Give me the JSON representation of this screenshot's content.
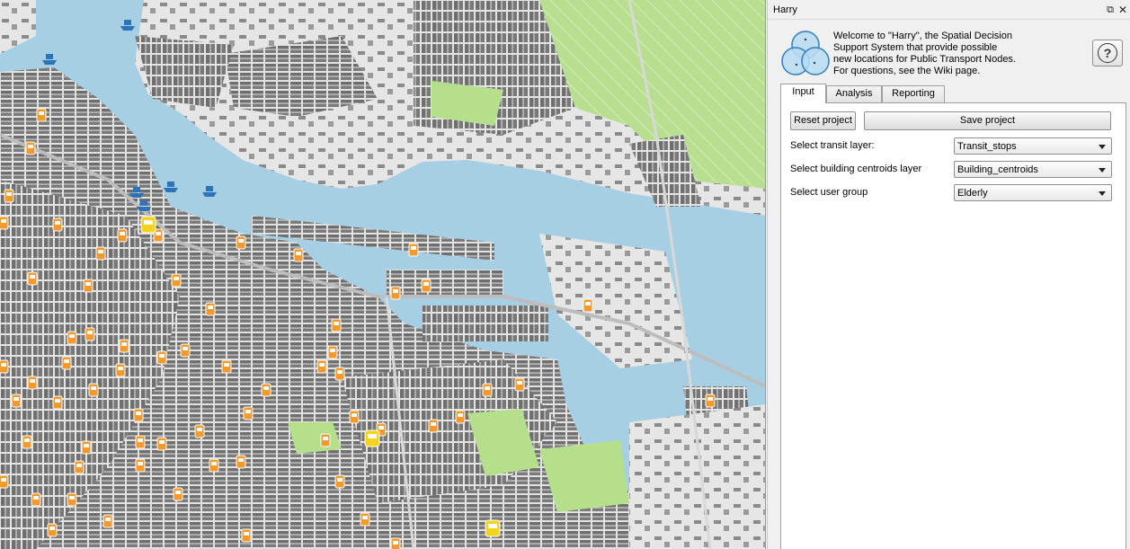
{
  "dock": {
    "title": "Harry",
    "float_icon": "float-window-icon",
    "close_icon": "close-icon"
  },
  "welcome": {
    "lines": [
      "Welcome to \"Harry\", the Spatial Decision",
      "Support System that provide possible",
      "new locations for Public Transport Nodes.",
      "For questions, see the Wiki page."
    ],
    "logo": "venn-circles-logo",
    "help_label": "?"
  },
  "tabs": [
    {
      "label": "Input",
      "active": true
    },
    {
      "label": "Analysis",
      "active": false
    },
    {
      "label": "Reporting",
      "active": false
    }
  ],
  "input_tab": {
    "reset_label": "Reset project",
    "save_label": "Save project",
    "transit": {
      "label": "Select transit layer:",
      "value": "Transit_stops"
    },
    "buildings": {
      "label": "Select building centroids layer",
      "value": "Building_centroids"
    },
    "user_group": {
      "label": "Select user group",
      "value": "Elderly"
    }
  },
  "map": {
    "colors": {
      "water": "#a7cfe3",
      "land": "#e3e3e3",
      "buildings": "#6f6f6f",
      "parks": "#b6df8c",
      "tram_stop": "#f29a2e",
      "station": "#f5d31c",
      "ferry": "#2d73b8"
    },
    "icons": [
      "tram-stop-icon",
      "train-station-icon",
      "ferry-icon"
    ]
  }
}
